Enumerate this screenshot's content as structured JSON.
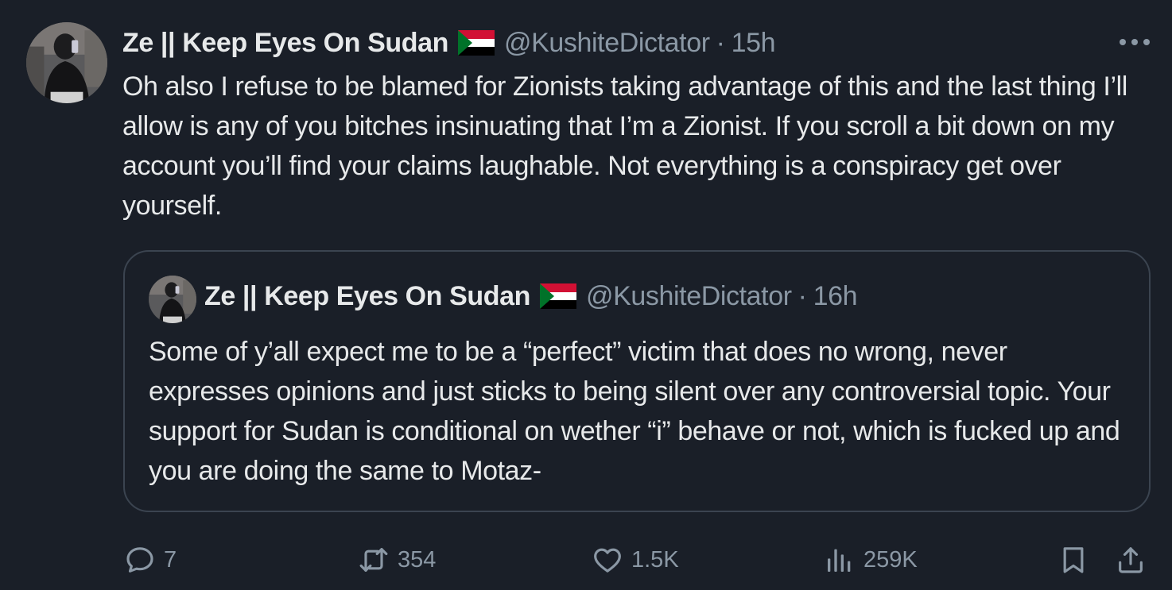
{
  "post": {
    "author_name": "Ze || Keep Eyes On Sudan",
    "flag_icon": "sudan-flag-icon",
    "handle": "@KushiteDictator",
    "separator": "·",
    "time": "15h",
    "text": "Oh also I refuse to be blamed for Zionists taking advantage of this and the last thing I’ll allow is any of you bitches insinuating that I’m a Zionist. If you scroll a bit down on my account you’ll find your claims laughable. Not everything is a conspiracy get over yourself."
  },
  "quoted_post": {
    "author_name": "Ze || Keep Eyes On Sudan",
    "flag_icon": "sudan-flag-icon",
    "handle": "@KushiteDictator",
    "separator": "·",
    "time": "16h",
    "text": "Some of y’all expect me to be a “perfect” victim that does no wrong, never expresses opinions and just sticks to being silent over any controversial topic. Your support for Sudan is conditional on wether “i” behave or not, which is fucked up and you are doing the same to Motaz-"
  },
  "actions": {
    "replies": "7",
    "reposts": "354",
    "likes": "1.5K",
    "views": "259K"
  },
  "colors": {
    "background": "#1a1f28",
    "text": "#e7e9ea",
    "muted": "#8b98a5",
    "border": "#3b4450"
  }
}
